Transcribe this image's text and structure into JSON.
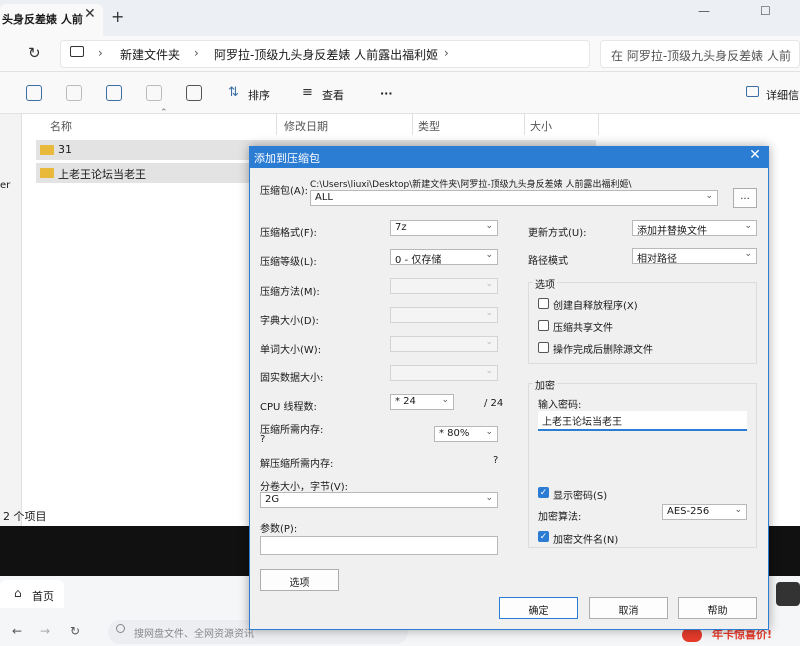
{
  "explorer": {
    "tab_title": "头身反差婊 人前",
    "tab_close": "✕",
    "tab_add": "+",
    "breadcrumb": [
      "新建文件夹",
      "阿罗拉-顶级九头身反差婊 人前露出福利姬"
    ],
    "search_placeholder": "在 阿罗拉-顶级九头身反差婊 人前",
    "toolbar": {
      "sort": "排序",
      "view": "查看",
      "more": "···",
      "details": "详细信"
    },
    "columns": [
      "名称",
      "修改日期",
      "类型",
      "大小"
    ],
    "rows": [
      {
        "name": "31"
      },
      {
        "name": "上老王论坛当老王"
      }
    ],
    "status": "2 个项目",
    "left_clip": "er"
  },
  "dialog": {
    "title": "添加到压缩包",
    "archive_label": "压缩包(A):",
    "archive_path": "C:\\Users\\liuxi\\Desktop\\新建文件夹\\阿罗拉-顶级九头身反差婊 人前露出福利姬\\",
    "archive_name": "ALL",
    "browse": "...",
    "format_label": "压缩格式(F):",
    "format": "7z",
    "level_label": "压缩等级(L):",
    "level": "0 - 仅存储",
    "method_label": "压缩方法(M):",
    "dict_label": "字典大小(D):",
    "word_label": "单词大小(W):",
    "solid_label": "固实数据大小:",
    "cpu_label": "CPU 线程数:",
    "cpu": "* 24",
    "cpu_total": "/ 24",
    "mem_label": "压缩所需内存:",
    "mem_q": "?",
    "mem": "* 80%",
    "demem_label": "解压缩所需内存:",
    "demem_q": "?",
    "volume_label": "分卷大小，字节(V):",
    "volume": "2G",
    "params_label": "参数(P):",
    "options_btn": "选项",
    "update_label": "更新方式(U):",
    "update": "添加并替换文件",
    "path_label": "路径模式",
    "path": "相对路径",
    "options_group": "选项",
    "opt_sfx": "创建自释放程序(X)",
    "opt_shared": "压缩共享文件",
    "opt_delete": "操作完成后删除源文件",
    "enc_group": "加密",
    "pwd_label": "输入密码:",
    "pwd": "上老王论坛当老王",
    "show_pwd": "显示密码(S)",
    "enc_method_label": "加密算法:",
    "enc_method": "AES-256",
    "enc_names": "加密文件名(N)",
    "ok": "确定",
    "cancel": "取消",
    "help": "帮助"
  },
  "netdisk": {
    "home": "首页",
    "search_placeholder": "搜网盘文件、全网资源资讯",
    "ad": "年卡惊喜价!"
  }
}
